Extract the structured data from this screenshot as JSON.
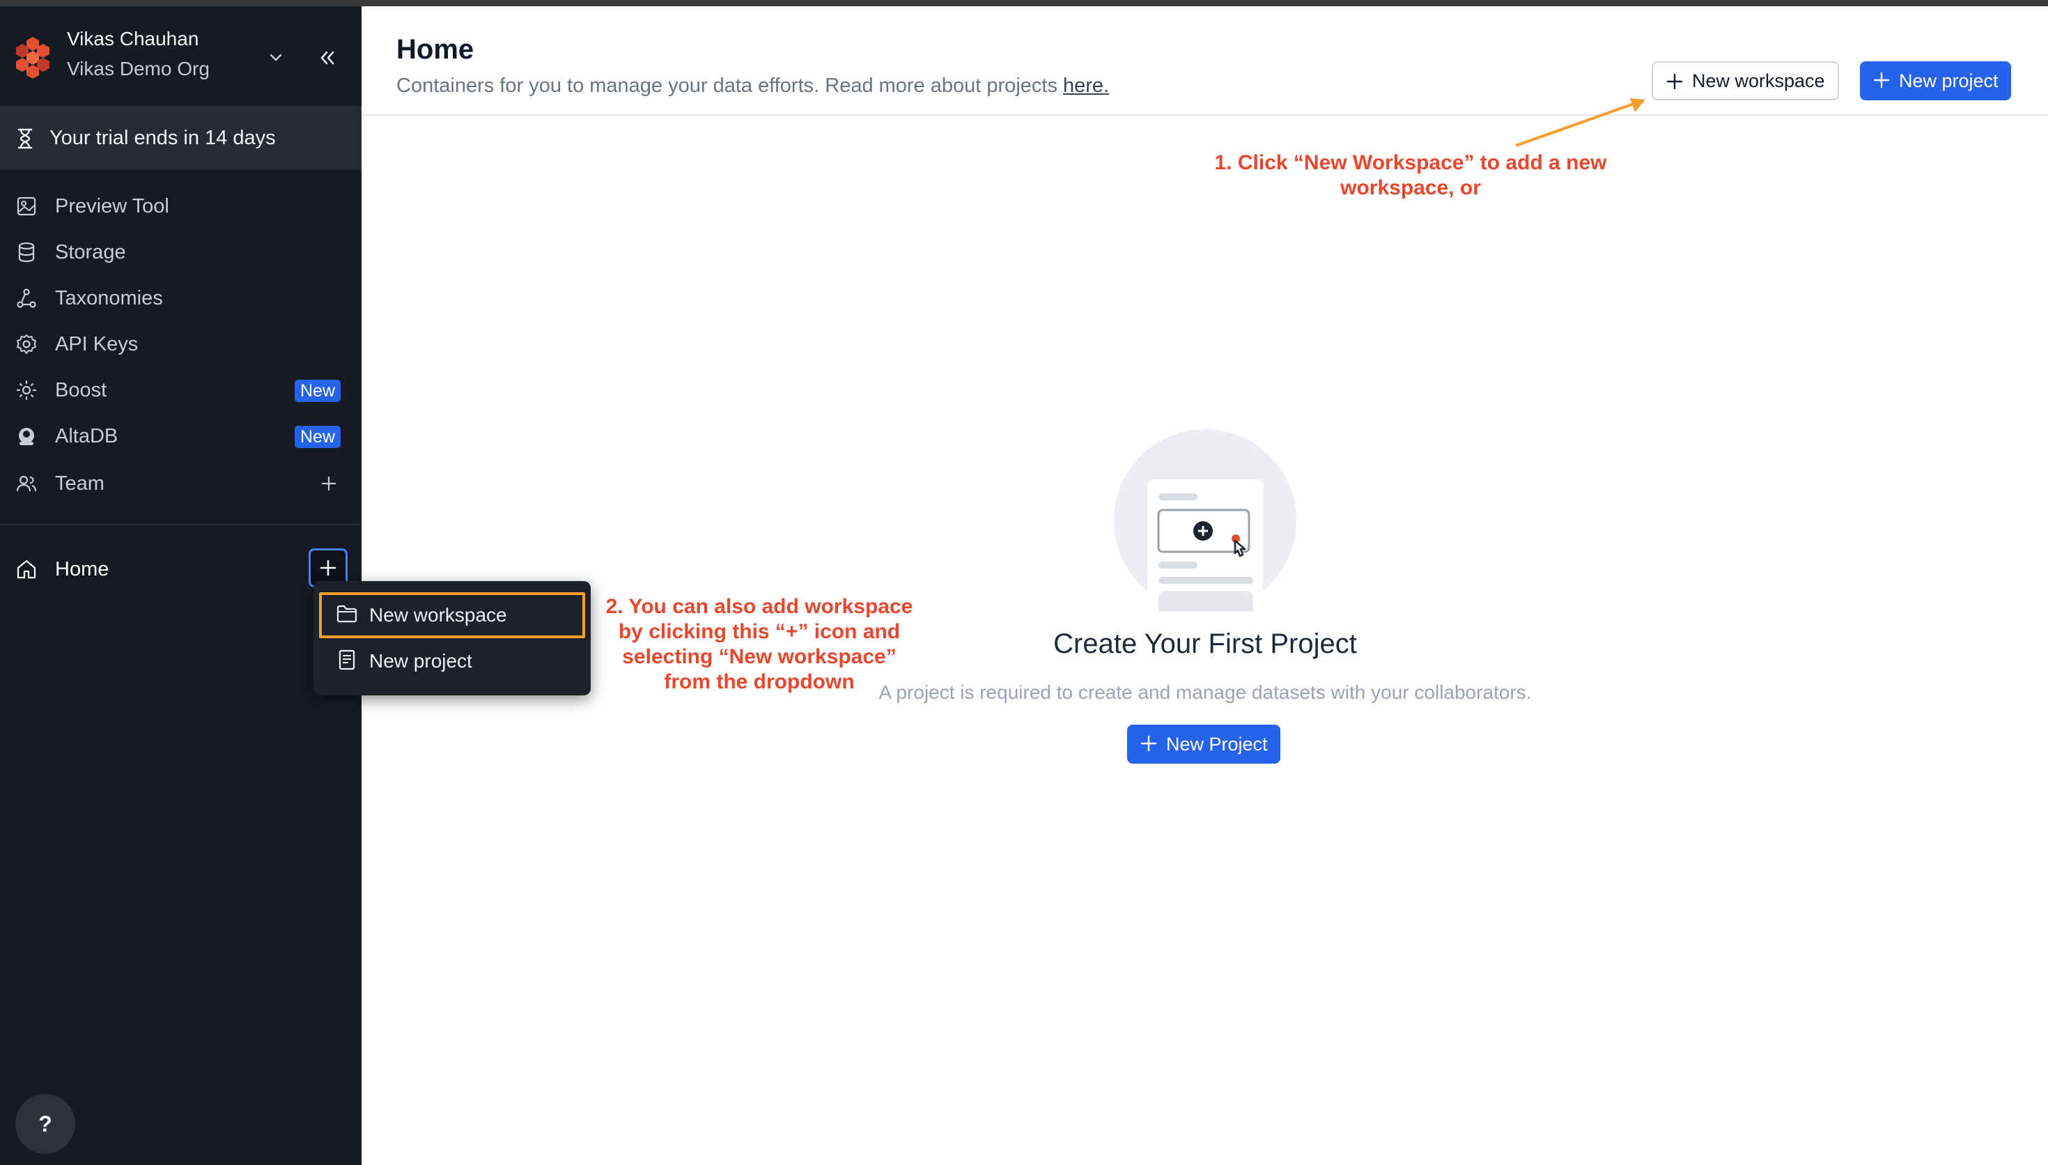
{
  "user": {
    "name": "Vikas Chauhan",
    "org": "Vikas Demo Org"
  },
  "trial": {
    "text": "Your trial ends in 14 days"
  },
  "sidebar": {
    "items": [
      {
        "label": "Preview Tool",
        "icon": "preview-icon"
      },
      {
        "label": "Storage",
        "icon": "database-icon"
      },
      {
        "label": "Taxonomies",
        "icon": "hierarchy-icon"
      },
      {
        "label": "API Keys",
        "icon": "gear-icon"
      },
      {
        "label": "Boost",
        "icon": "sun-icon",
        "badge": "New"
      },
      {
        "label": "AltaDB",
        "icon": "altadb-icon",
        "badge": "New"
      },
      {
        "label": "Team",
        "icon": "users-icon"
      }
    ],
    "home_label": "Home",
    "help_label": "?"
  },
  "dropdown": {
    "items": [
      {
        "label": "New workspace",
        "icon": "folder-icon"
      },
      {
        "label": "New project",
        "icon": "document-icon"
      }
    ]
  },
  "header": {
    "title": "Home",
    "subtitle": "Containers for you to manage your data efforts. Read more about projects ",
    "link_text": "here.",
    "new_workspace_label": "New workspace",
    "new_project_label": "New project"
  },
  "annotations": {
    "first": "1. Click “New Workspace” to add a new workspace, or",
    "second": "2. You can also add workspace by clicking this “+” icon and selecting “New workspace” from the dropdown"
  },
  "empty_state": {
    "title": "Create Your First Project",
    "description": "A project is required to create and manage datasets with your collaborators.",
    "button_label": "New Project"
  },
  "colors": {
    "sidebar_bg": "#161a23",
    "accent": "#2563eb",
    "annotation": "#e8472e",
    "highlight": "#f59e2c"
  }
}
